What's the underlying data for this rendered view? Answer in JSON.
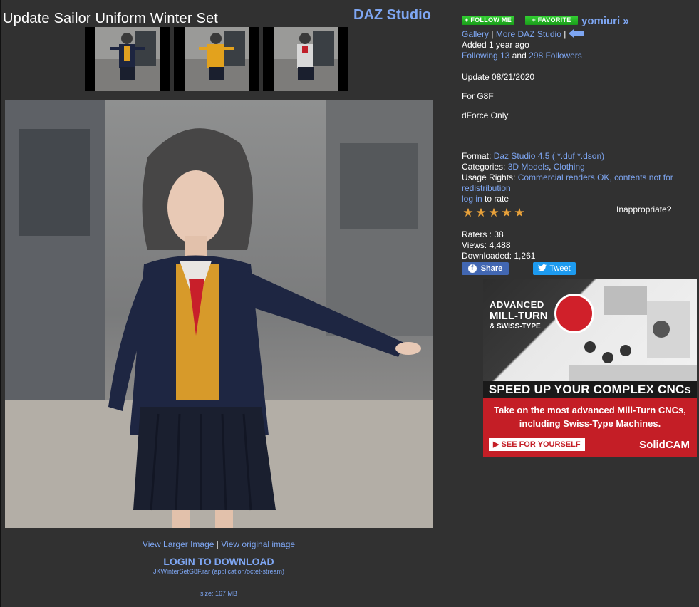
{
  "page": {
    "title": "Update Sailor Uniform Winter Set",
    "software": "DAZ Studio"
  },
  "main": {
    "view_larger": "View Larger Image",
    "sep": "|",
    "view_original": "View original image",
    "login_download": "LOGIN TO DOWNLOAD",
    "file_info": "JKWinterSetG8F.rar (application/octet-stream)",
    "size": "size: 167 MB"
  },
  "sidebar": {
    "follow_label": "+ FOLLOW ME",
    "favorite_label": "+ FAVORITE",
    "username": "yomiuri »",
    "gallery_link": "Gallery",
    "more_link": "More DAZ Studio",
    "added": "Added 1 year ago",
    "following_link": "Following 13",
    "and": "and",
    "followers_link": "298 Followers",
    "description": [
      "Update 08/21/2020",
      "For G8F",
      "dForce Only"
    ],
    "format_label": "Format:",
    "format_value": "Daz Studio 4.5 ( *.duf *.dson)",
    "categories_label": "Categories:",
    "category_1": "3D Models",
    "category_2": "Clothing",
    "usage_label": "Usage Rights:",
    "usage_value": "Commercial renders OK, contents not for redistribution",
    "login_link": "log in",
    "to_rate": "to rate",
    "inappropriate": "Inappropriate?",
    "raters": "Raters : 38",
    "views": "Views: 4,488",
    "downloaded": "Downloaded: 1,261",
    "rating_stars": 5,
    "share_label": "Share",
    "tweet_label": "Tweet"
  },
  "ad": {
    "line1": "ADVANCED",
    "line2": "MILL-TURN",
    "line3": "& SWISS-TYPE",
    "headline": "SPEED UP YOUR COMPLEX CNCs",
    "sub1": "Take on the most advanced Mill-Turn CNCs,",
    "sub2": "including Swiss-Type Machines.",
    "cta": "▶ SEE FOR YOURSELF",
    "logo": "SolidCAM"
  },
  "colors": {
    "background": "#313131",
    "link": "#7ea6f2",
    "follow_green": "#22b322",
    "star": "#e8a13a"
  }
}
